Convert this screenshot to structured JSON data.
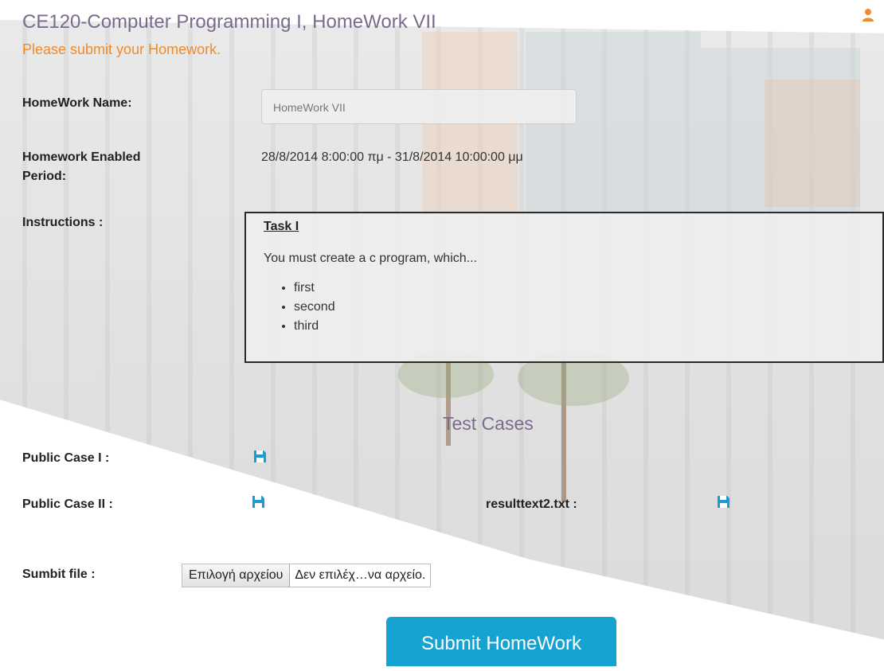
{
  "header": {
    "title": "CE120-Computer Programming I, HomeWork VII",
    "subtitle": "Please submit your Homework."
  },
  "icons": {
    "user": "user-icon",
    "save": "floppy-disk-icon"
  },
  "form": {
    "homework_name_label": "HomeWork Name:",
    "homework_name_value": "HomeWork VII",
    "enabled_period_label_line1": "Homework Enabled",
    "enabled_period_label_line2": "Period:",
    "enabled_period_value": "28/8/2014 8:00:00 πμ - 31/8/2014 10:00:00 μμ",
    "instructions_label": "Instructions :",
    "instructions": {
      "task_title": "Task I",
      "description": "You must create a c program, which...",
      "items": [
        "first",
        "second",
        "third"
      ]
    }
  },
  "test_cases": {
    "title": "Test Cases",
    "public_case_1_label": "Public Case I :",
    "public_case_2_label": "Public Case II :",
    "result_file_label": "resulttext2.txt :"
  },
  "submit": {
    "file_label": "Sumbit file :",
    "file_button": "Επιλογή αρχείου",
    "file_status": "Δεν επιλέχ…να αρχείο.",
    "submit_button": "Submit HomeWork"
  },
  "colors": {
    "title": "#7a6a8c",
    "subtitle": "#f08a2b",
    "icon_blue": "#1a9ad6",
    "submit_bg": "#17a3d1",
    "user_icon": "#f08a2b"
  }
}
